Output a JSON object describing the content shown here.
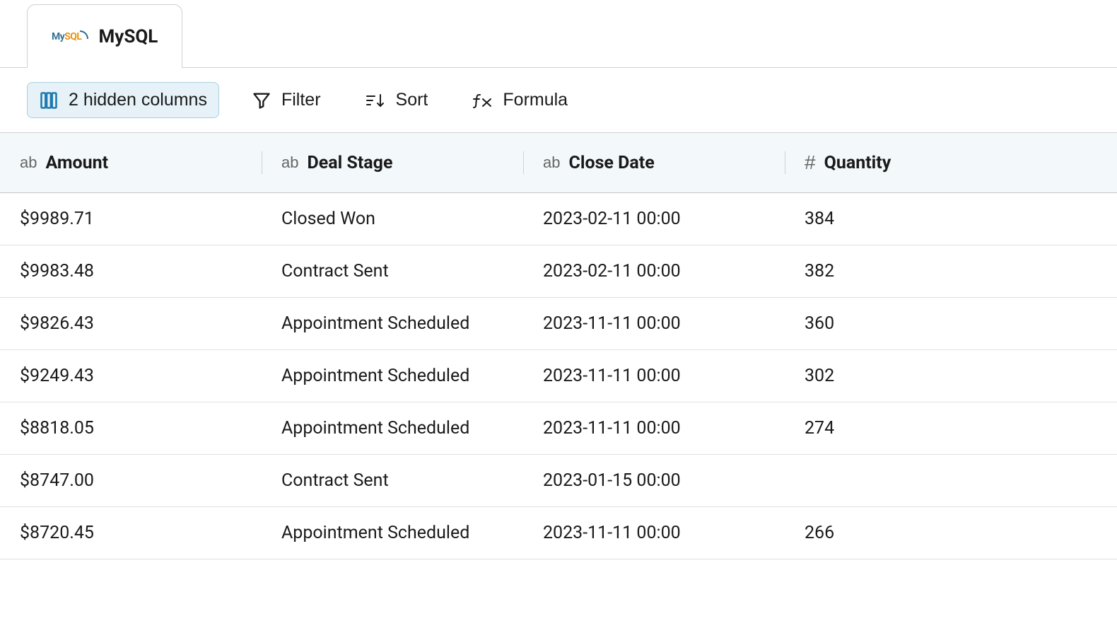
{
  "tab": {
    "label": "MySQL",
    "logo_my": "My",
    "logo_sql": "SQL"
  },
  "toolbar": {
    "hidden_columns": "2 hidden columns",
    "filter": "Filter",
    "sort": "Sort",
    "formula": "Formula"
  },
  "columns": [
    {
      "type": "ab",
      "label": "Amount"
    },
    {
      "type": "ab",
      "label": "Deal Stage"
    },
    {
      "type": "ab",
      "label": "Close Date"
    },
    {
      "type": "#",
      "label": "Quantity"
    }
  ],
  "rows": [
    {
      "amount": "$9989.71",
      "deal_stage": "Closed Won",
      "close_date": "2023-02-11 00:00",
      "quantity": "384"
    },
    {
      "amount": "$9983.48",
      "deal_stage": "Contract Sent",
      "close_date": "2023-02-11 00:00",
      "quantity": "382"
    },
    {
      "amount": "$9826.43",
      "deal_stage": "Appointment Scheduled",
      "close_date": "2023-11-11 00:00",
      "quantity": "360"
    },
    {
      "amount": "$9249.43",
      "deal_stage": "Appointment Scheduled",
      "close_date": "2023-11-11 00:00",
      "quantity": "302"
    },
    {
      "amount": "$8818.05",
      "deal_stage": "Appointment Scheduled",
      "close_date": "2023-11-11 00:00",
      "quantity": "274"
    },
    {
      "amount": "$8747.00",
      "deal_stage": "Contract Sent",
      "close_date": "2023-01-15 00:00",
      "quantity": ""
    },
    {
      "amount": "$8720.45",
      "deal_stage": "Appointment Scheduled",
      "close_date": "2023-11-11 00:00",
      "quantity": "266"
    }
  ]
}
